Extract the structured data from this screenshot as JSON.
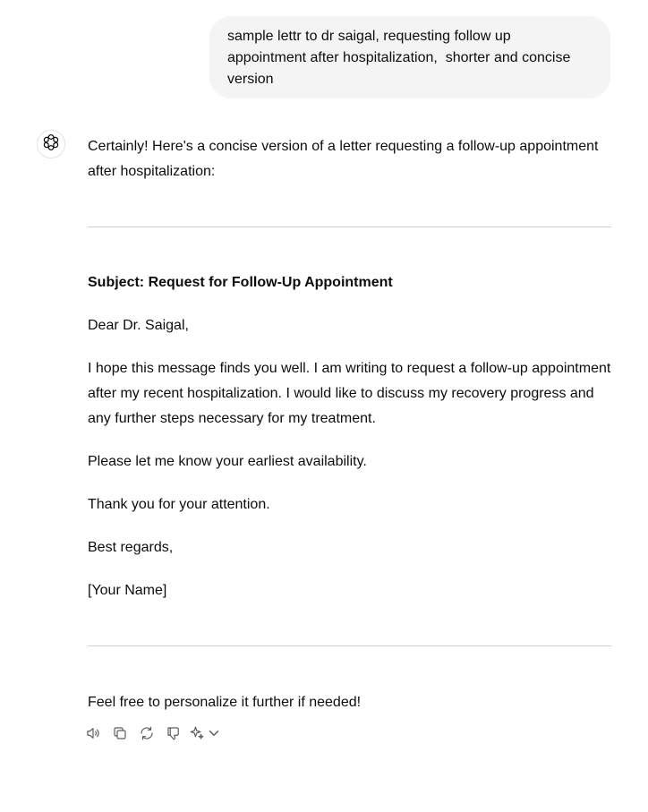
{
  "user_message": "sample lettr to dr saigal, requesting follow up appointment after hospitalization,  shorter and concise version",
  "assistant": {
    "intro": "Certainly! Here's a concise version of a letter requesting a follow-up appointment after hospitalization:",
    "letter": {
      "subject": "Subject: Request for Follow-Up Appointment",
      "greeting": "Dear Dr. Saigal,",
      "body": "I hope this message finds you well. I am writing to request a follow-up appointment after my recent hospitalization. I would like to discuss my recovery progress and any further steps necessary for my treatment.",
      "availability": "Please let me know your earliest availability.",
      "thanks": "Thank you for your attention.",
      "regards": "Best regards,",
      "signature": "[Your Name]"
    },
    "closing": "Feel free to personalize it further if needed!"
  },
  "actions": {
    "icons": [
      "speaker-icon",
      "copy-icon",
      "regenerate-icon",
      "thumbs-down-icon",
      "sparkle-icon",
      "chevron-down-icon"
    ]
  },
  "colors": {
    "user_bubble_bg": "#f4f4f4",
    "text": "#0d0d0d",
    "icon": "#5d5d5d",
    "divider": "#cfcfcf"
  }
}
